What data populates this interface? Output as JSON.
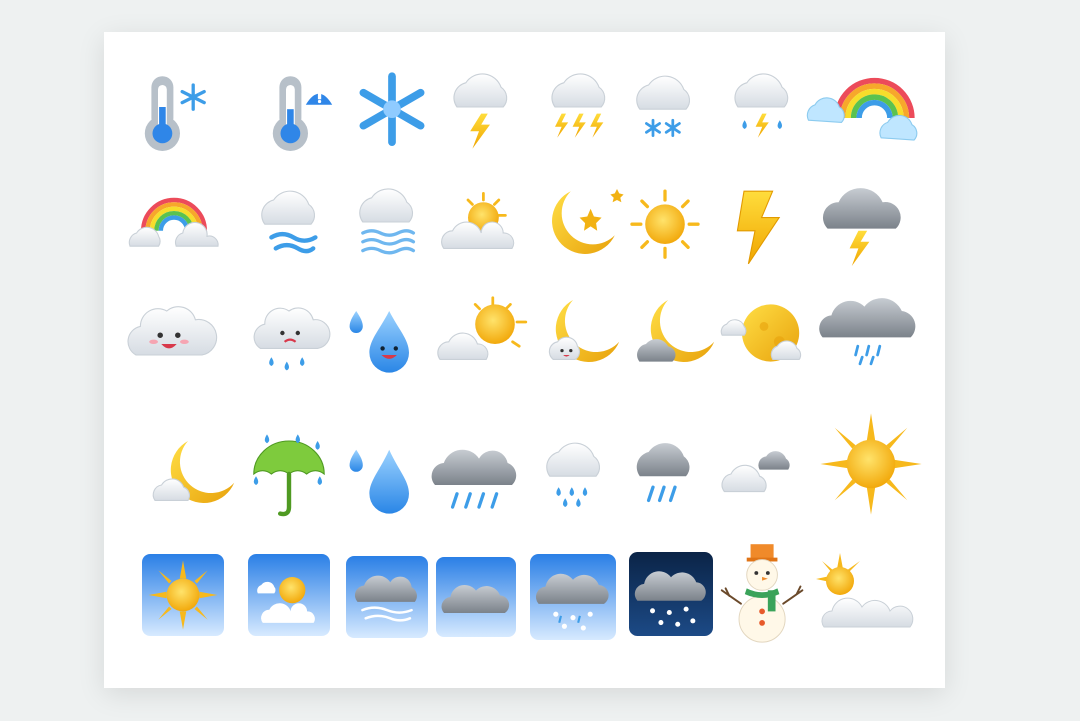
{
  "sheet": {
    "background": "#eef1f1",
    "card_color": "#ffffff",
    "accent_colors": {
      "sun": "#f7b91c",
      "cloud": "#eef0f3",
      "gray_cloud": "#9aa0a7",
      "rain": "#3d9de8",
      "bolt": "#f5c218",
      "tile_blue": "#2f86e8",
      "night_tile": "#0f2d55"
    }
  },
  "rows": [
    [
      "thermometer-snow-icon",
      "thermometer-warning-icon",
      "snowflake-icon",
      "cloud-lightning-icon",
      "cloud-double-lightning-icon",
      "cloud-snow-icon",
      "cloud-rain-lightning-icon",
      "rainbow-clouds-icon"
    ],
    [
      "rainbow-icon",
      "cloud-wind-icon",
      "fog-icon",
      "sun-behind-cloud-icon",
      "moon-star-icon",
      "sun-icon",
      "lightning-bolt-icon",
      "dark-cloud-lightning-icon"
    ],
    [
      "smiling-cloud-icon",
      "sad-cloud-rain-icon",
      "smiling-raindrop-icon",
      "partly-sunny-icon",
      "moon-cute-cloud-icon",
      "moon-gray-cloud-icon",
      "full-moon-clouds-icon",
      "heavy-cloud-drizzle-icon"
    ],
    [
      "moon-behind-cloud-icon",
      "umbrella-rain-icon",
      "raindrops-icon",
      "gray-cloud-rain-icon",
      "cloud-rain-drops-icon",
      "dark-cloud-rain-icon",
      "clouds-icon",
      "bright-sun-icon"
    ],
    [
      "sun-tile-icon",
      "sun-cloud-tile-icon",
      "wind-cloud-tile-icon",
      "overcast-tile-icon",
      "sleet-tile-icon",
      "night-snow-tile-icon",
      "snowman-icon",
      "sun-cloud-icon"
    ]
  ]
}
